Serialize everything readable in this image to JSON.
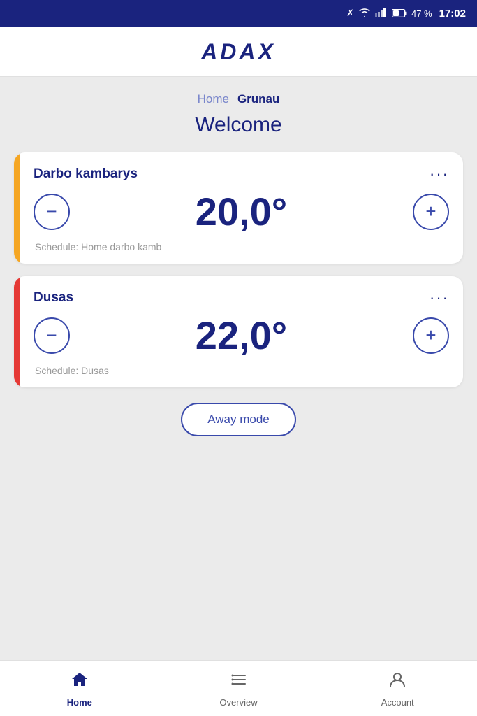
{
  "statusBar": {
    "battery": "47 %",
    "time": "17:02"
  },
  "header": {
    "logo": "ADAX"
  },
  "breadcrumb": {
    "home": "Home",
    "current": "Grunau"
  },
  "welcome": "Welcome",
  "devices": [
    {
      "id": "darbo",
      "name": "Darbo kambarys",
      "temperature": "20,0°",
      "schedule": "Schedule: Home darbo kamb",
      "colorBar": "yellow"
    },
    {
      "id": "dusas",
      "name": "Dusas",
      "temperature": "22,0°",
      "schedule": "Schedule: Dusas",
      "colorBar": "orange"
    }
  ],
  "awayMode": {
    "label": "Away mode"
  },
  "nav": {
    "items": [
      {
        "id": "home",
        "label": "Home",
        "active": true
      },
      {
        "id": "overview",
        "label": "Overview",
        "active": false
      },
      {
        "id": "account",
        "label": "Account",
        "active": false
      }
    ]
  }
}
